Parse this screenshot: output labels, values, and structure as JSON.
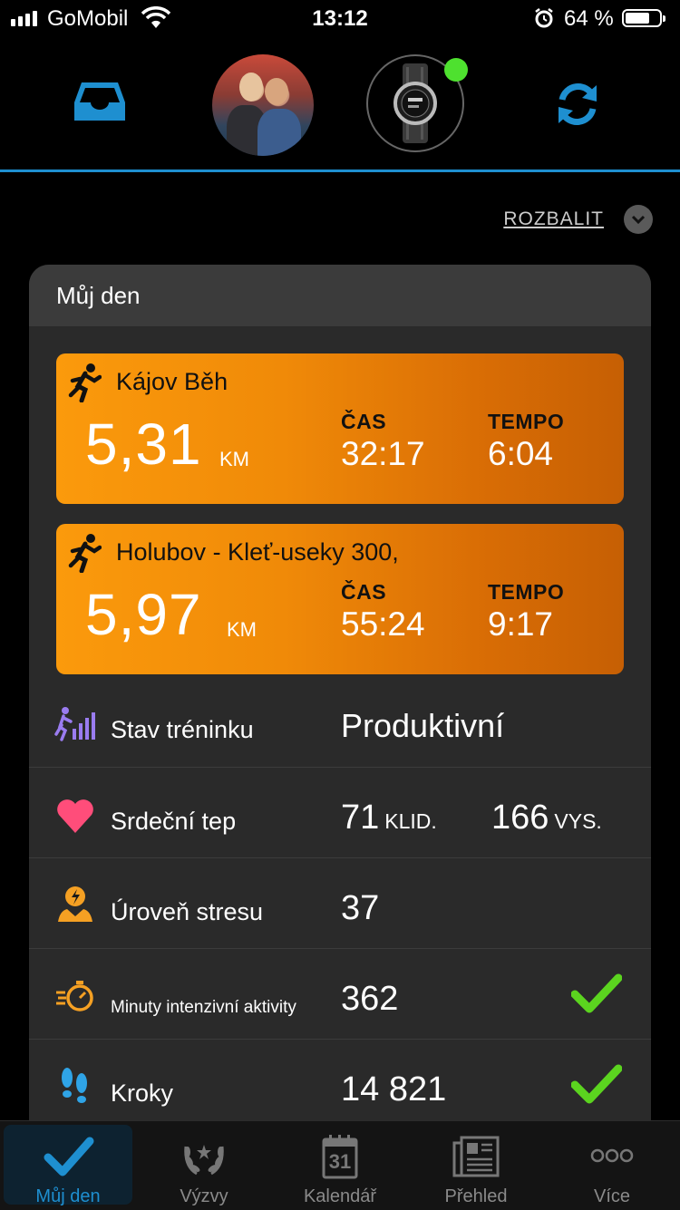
{
  "status_bar": {
    "carrier": "GoMobil",
    "time": "13:12",
    "battery": "64 %"
  },
  "header": {
    "expand_label": "ROZBALIT"
  },
  "card": {
    "title": "Můj den",
    "activities": [
      {
        "name": "Kájov Běh",
        "distance": "5,31",
        "unit": "KM",
        "time_label": "ČAS",
        "time": "32:17",
        "pace_label": "TEMPO",
        "pace": "6:04"
      },
      {
        "name": "Holubov - Kleť-useky 300,",
        "distance": "5,97",
        "unit": "KM",
        "time_label": "ČAS",
        "time": "55:24",
        "pace_label": "TEMPO",
        "pace": "9:17"
      }
    ],
    "rows": {
      "training": {
        "label": "Stav tréninku",
        "value": "Produktivní"
      },
      "heart": {
        "label": "Srdeční tep",
        "rest_value": "71",
        "rest_unit": "KLID.",
        "high_value": "166",
        "high_unit": "VYS."
      },
      "stress": {
        "label": "Úroveň stresu",
        "value": "37"
      },
      "intensity": {
        "label": "Minuty intenzivní aktivity",
        "value": "362"
      },
      "steps": {
        "label": "Kroky",
        "value": "14 821"
      }
    }
  },
  "tabs": [
    {
      "label": "Můj den",
      "icon": "check-icon"
    },
    {
      "label": "Výzvy",
      "icon": "laurel-icon"
    },
    {
      "label": "Kalendář",
      "icon": "calendar-icon",
      "day": "31"
    },
    {
      "label": "Přehled",
      "icon": "newsfeed-icon"
    },
    {
      "label": "Více",
      "icon": "more-icon"
    }
  ],
  "colors": {
    "accent": "#1e8fd0",
    "activity_orange": "#f08a08",
    "connected": "#4ee12f",
    "check": "#5bd41f"
  }
}
